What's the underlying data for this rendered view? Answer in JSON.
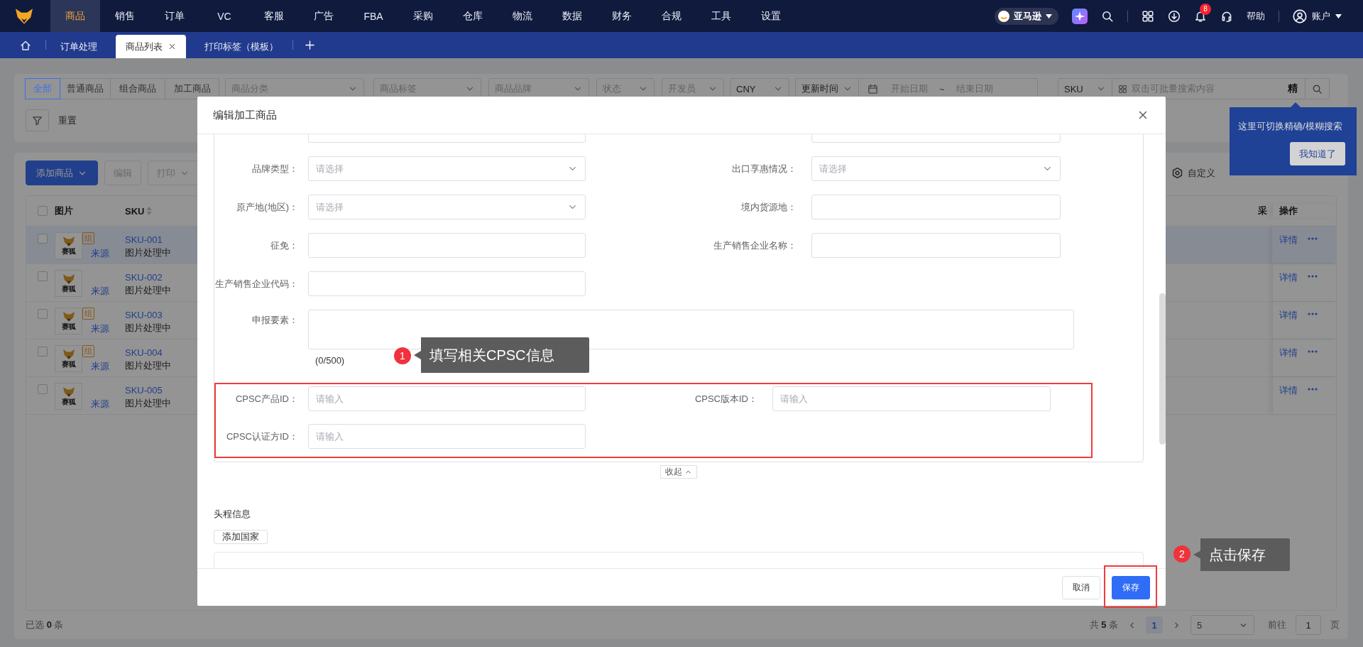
{
  "top_nav": {
    "menu": [
      {
        "label": "商品",
        "selected": true
      },
      {
        "label": "销售",
        "selected": false
      },
      {
        "label": "订单",
        "selected": false
      },
      {
        "label": "VC",
        "selected": false
      },
      {
        "label": "客服",
        "selected": false
      },
      {
        "label": "广告",
        "selected": false
      },
      {
        "label": "FBA",
        "selected": false
      },
      {
        "label": "采购",
        "selected": false
      },
      {
        "label": "仓库",
        "selected": false
      },
      {
        "label": "物流",
        "selected": false
      },
      {
        "label": "数据",
        "selected": false
      },
      {
        "label": "财务",
        "selected": false
      },
      {
        "label": "合规",
        "selected": false
      },
      {
        "label": "工具",
        "selected": false
      },
      {
        "label": "设置",
        "selected": false
      }
    ],
    "marketplace": "亚马逊",
    "notification_count": "8",
    "help": "帮助",
    "account": "账户"
  },
  "tabs": [
    {
      "label": "订单处理",
      "selected": false
    },
    {
      "label": "商品列表",
      "selected": true
    },
    {
      "label": "打印标签（模板）",
      "selected": false
    }
  ],
  "filters": {
    "type_tabs": [
      {
        "label": "全部",
        "selected": true
      },
      {
        "label": "普通商品",
        "selected": false
      },
      {
        "label": "组合商品",
        "selected": false
      },
      {
        "label": "加工商品",
        "selected": false
      }
    ],
    "selects": [
      {
        "placeholder": "商品分类"
      },
      {
        "placeholder": "商品标签"
      },
      {
        "placeholder": "商品品牌"
      },
      {
        "placeholder": "状态"
      },
      {
        "placeholder": "开发员"
      },
      {
        "value": "CNY"
      }
    ],
    "time_field": "更新时间",
    "start_placeholder": "开始日期",
    "range_separator": "~",
    "end_placeholder": "结束日期",
    "search_field": "SKU",
    "search_placeholder": "双击可批量搜索内容",
    "exact_toggle": "精",
    "reset": "重置"
  },
  "toolbar": {
    "buttons": [
      {
        "label": "添加商品",
        "kind": "primary",
        "disabled": false,
        "menu": true
      },
      {
        "label": "编辑",
        "kind": "default",
        "disabled": true,
        "menu": false
      },
      {
        "label": "打印",
        "kind": "default",
        "disabled": true,
        "menu": true
      }
    ],
    "custom_columns": "自定义"
  },
  "table": {
    "columns": [
      "图片",
      "SKU",
      "采",
      "操作"
    ],
    "header_checked": false,
    "rows": [
      {
        "checked": false,
        "selected": true,
        "thumb_label": "赛狐",
        "combo_tag": "组",
        "source": "来源",
        "sku": "SKU-001",
        "status": "图片处理中",
        "detail": "详情"
      },
      {
        "checked": false,
        "selected": false,
        "thumb_label": "赛狐",
        "source": "来源",
        "sku": "SKU-002",
        "status": "图片处理中",
        "detail": "详情"
      },
      {
        "checked": false,
        "selected": false,
        "thumb_label": "赛狐",
        "combo_tag": "组",
        "source": "来源",
        "sku": "SKU-003",
        "status": "图片处理中",
        "detail": "详情"
      },
      {
        "checked": false,
        "selected": false,
        "thumb_label": "赛狐",
        "combo_tag": "组",
        "source": "来源",
        "sku": "SKU-004",
        "status": "图片处理中",
        "detail": "详情"
      },
      {
        "checked": false,
        "selected": false,
        "thumb_label": "赛狐",
        "source": "来源",
        "sku": "SKU-005",
        "status": "图片处理中",
        "detail": "详情"
      }
    ]
  },
  "pagination": {
    "selected_text": "已选 **0** 条",
    "total_text": "共 **5** 条",
    "pages": [
      {
        "label": "1",
        "selected": true
      }
    ],
    "page_size": "5",
    "goto_label": "前往",
    "goto_value": "1",
    "goto_suffix": "页"
  },
  "popover": {
    "text": "这里可切换精确/模糊搜索",
    "button": "我知道了"
  },
  "modal": {
    "title": "编辑加工商品",
    "field_rows": [
      [
        {
          "kind": "input"
        },
        {
          "kind": "input"
        }
      ],
      [
        {
          "label": "品牌类型：",
          "kind": "select",
          "placeholder": "请选择"
        },
        {
          "label": "出口享惠情况：",
          "kind": "select",
          "placeholder": "请选择"
        }
      ],
      [
        {
          "label": "原产地(地区)：",
          "kind": "select",
          "placeholder": "请选择"
        },
        {
          "label": "境内货源地：",
          "kind": "input"
        }
      ],
      [
        {
          "label": "征免：",
          "kind": "input"
        },
        {
          "label": "生产销售企业名称：",
          "kind": "input"
        }
      ],
      [
        {
          "label": "生产销售企业代码：",
          "kind": "input"
        }
      ],
      [
        {
          "label": "申报要素：",
          "kind": "textarea",
          "counter": "(0/500)"
        }
      ]
    ],
    "cpsc_rows": [
      [
        {
          "label": "CPSC产品ID：",
          "kind": "input",
          "placeholder": "请输入"
        },
        {
          "label": "CPSC版本ID：",
          "kind": "input",
          "placeholder": "请输入"
        }
      ],
      [
        {
          "label": "CPSC认证方ID：",
          "kind": "input",
          "placeholder": "请输入"
        }
      ]
    ],
    "collapse": "收起",
    "section_title": "头程信息",
    "add_country": "添加国家",
    "cancel": "取消",
    "save": "保存"
  },
  "guides": [
    {
      "number": "1",
      "text": "填写相关CPSC信息"
    },
    {
      "number": "2",
      "text": "点击保存"
    }
  ]
}
